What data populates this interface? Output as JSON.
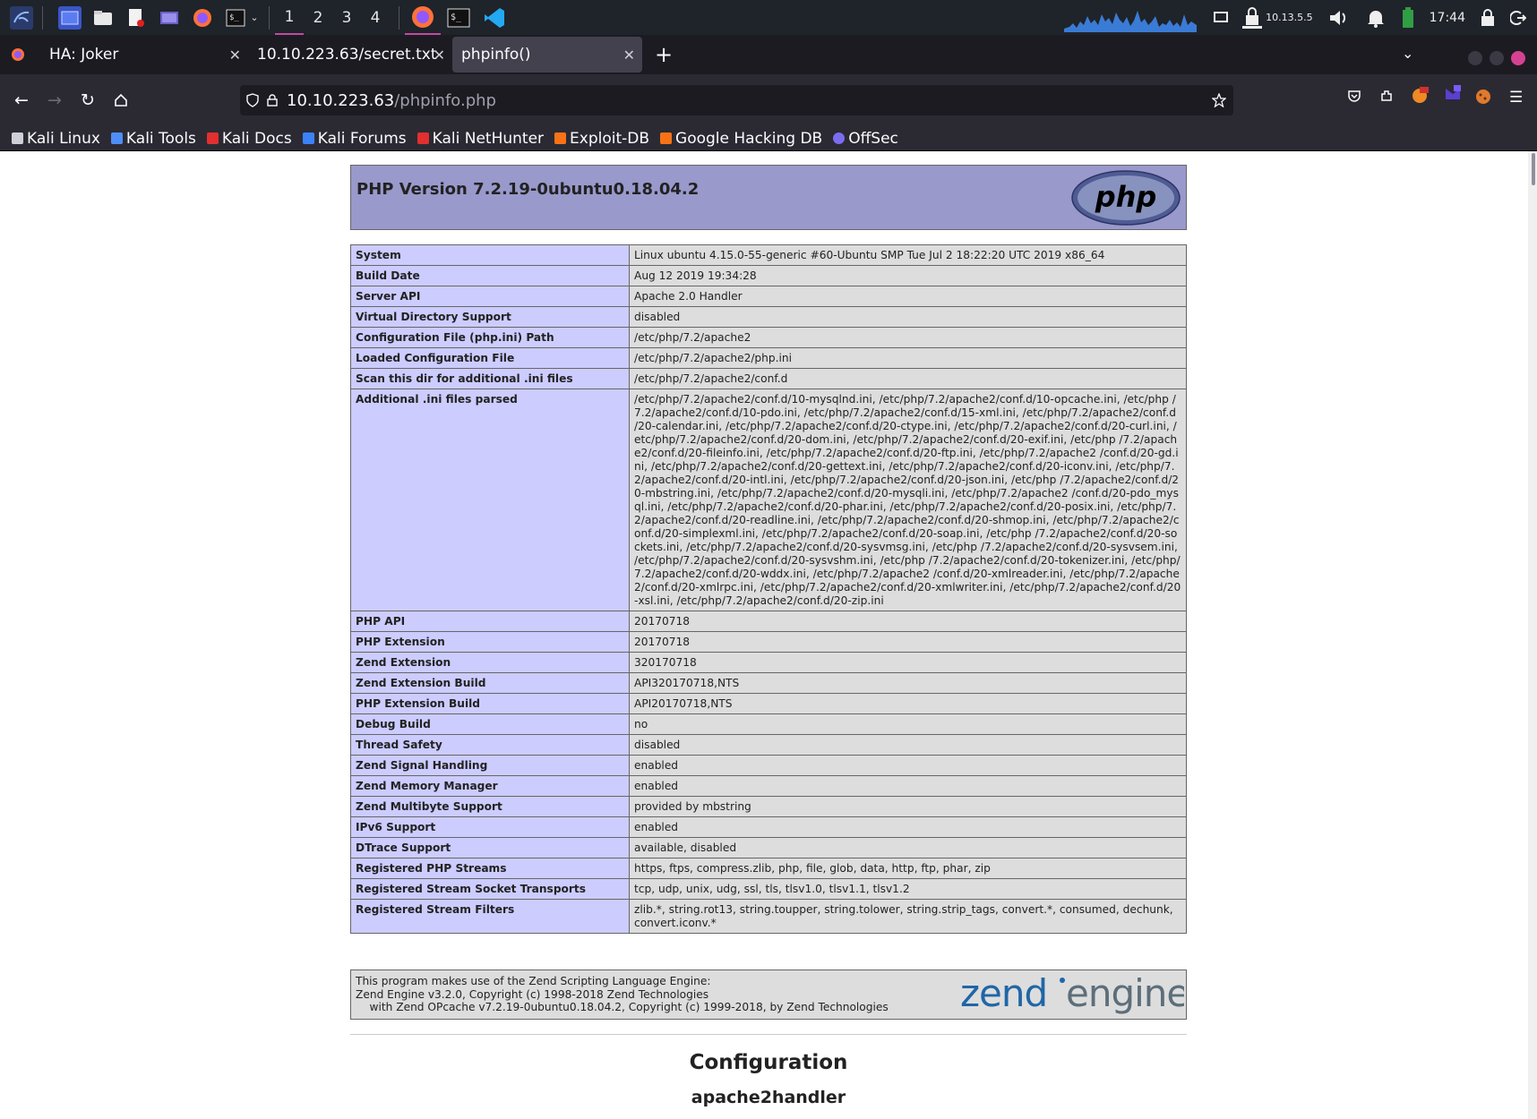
{
  "panel": {
    "workspaces": [
      "1",
      "2",
      "3",
      "4"
    ],
    "active_workspace": "1",
    "ip": "10.13.5.5",
    "clock": "17:44"
  },
  "tabs": [
    {
      "title": "HA: Joker",
      "active": false
    },
    {
      "title": "10.10.223.63/secret.txt",
      "active": false
    },
    {
      "title": "phpinfo()",
      "active": true
    }
  ],
  "url": {
    "host": "10.10.223.63",
    "path": "/phpinfo.php"
  },
  "bookmarks": [
    {
      "label": "Kali Linux",
      "color": "#cfcfd8"
    },
    {
      "label": "Kali Tools",
      "color": "#4f8ef7"
    },
    {
      "label": "Kali Docs",
      "color": "#e22f2f"
    },
    {
      "label": "Kali Forums",
      "color": "#3b82f6"
    },
    {
      "label": "Kali NetHunter",
      "color": "#e22f2f"
    },
    {
      "label": "Exploit-DB",
      "color": "#f97316"
    },
    {
      "label": "Google Hacking DB",
      "color": "#f97316"
    },
    {
      "label": "OffSec",
      "color": "#7c6cf0"
    }
  ],
  "phpinfo": {
    "version": "PHP Version 7.2.19-0ubuntu0.18.04.2",
    "logo_text": "php",
    "rows": [
      {
        "k": "System",
        "v": "Linux ubuntu 4.15.0-55-generic #60-Ubuntu SMP Tue Jul 2 18:22:20 UTC 2019 x86_64"
      },
      {
        "k": "Build Date",
        "v": "Aug 12 2019 19:34:28"
      },
      {
        "k": "Server API",
        "v": "Apache 2.0 Handler"
      },
      {
        "k": "Virtual Directory Support",
        "v": "disabled"
      },
      {
        "k": "Configuration File (php.ini) Path",
        "v": "/etc/php/7.2/apache2"
      },
      {
        "k": "Loaded Configuration File",
        "v": "/etc/php/7.2/apache2/php.ini"
      },
      {
        "k": "Scan this dir for additional .ini files",
        "v": "/etc/php/7.2/apache2/conf.d"
      },
      {
        "k": "Additional .ini files parsed",
        "v": "/etc/php/7.2/apache2/conf.d/10-mysqlnd.ini, /etc/php/7.2/apache2/conf.d/10-opcache.ini, /etc/php /7.2/apache2/conf.d/10-pdo.ini, /etc/php/7.2/apache2/conf.d/15-xml.ini, /etc/php/7.2/apache2/conf.d /20-calendar.ini, /etc/php/7.2/apache2/conf.d/20-ctype.ini, /etc/php/7.2/apache2/conf.d/20-curl.ini, /etc/php/7.2/apache2/conf.d/20-dom.ini, /etc/php/7.2/apache2/conf.d/20-exif.ini, /etc/php /7.2/apache2/conf.d/20-fileinfo.ini, /etc/php/7.2/apache2/conf.d/20-ftp.ini, /etc/php/7.2/apache2 /conf.d/20-gd.ini, /etc/php/7.2/apache2/conf.d/20-gettext.ini, /etc/php/7.2/apache2/conf.d/20-iconv.ini, /etc/php/7.2/apache2/conf.d/20-intl.ini, /etc/php/7.2/apache2/conf.d/20-json.ini, /etc/php /7.2/apache2/conf.d/20-mbstring.ini, /etc/php/7.2/apache2/conf.d/20-mysqli.ini, /etc/php/7.2/apache2 /conf.d/20-pdo_mysql.ini, /etc/php/7.2/apache2/conf.d/20-phar.ini, /etc/php/7.2/apache2/conf.d/20-posix.ini, /etc/php/7.2/apache2/conf.d/20-readline.ini, /etc/php/7.2/apache2/conf.d/20-shmop.ini, /etc/php/7.2/apache2/conf.d/20-simplexml.ini, /etc/php/7.2/apache2/conf.d/20-soap.ini, /etc/php /7.2/apache2/conf.d/20-sockets.ini, /etc/php/7.2/apache2/conf.d/20-sysvmsg.ini, /etc/php /7.2/apache2/conf.d/20-sysvsem.ini, /etc/php/7.2/apache2/conf.d/20-sysvshm.ini, /etc/php /7.2/apache2/conf.d/20-tokenizer.ini, /etc/php/7.2/apache2/conf.d/20-wddx.ini, /etc/php/7.2/apache2 /conf.d/20-xmlreader.ini, /etc/php/7.2/apache2/conf.d/20-xmlrpc.ini, /etc/php/7.2/apache2/conf.d/20-xmlwriter.ini, /etc/php/7.2/apache2/conf.d/20-xsl.ini, /etc/php/7.2/apache2/conf.d/20-zip.ini"
      },
      {
        "k": "PHP API",
        "v": "20170718"
      },
      {
        "k": "PHP Extension",
        "v": "20170718"
      },
      {
        "k": "Zend Extension",
        "v": "320170718"
      },
      {
        "k": "Zend Extension Build",
        "v": "API320170718,NTS"
      },
      {
        "k": "PHP Extension Build",
        "v": "API20170718,NTS"
      },
      {
        "k": "Debug Build",
        "v": "no"
      },
      {
        "k": "Thread Safety",
        "v": "disabled"
      },
      {
        "k": "Zend Signal Handling",
        "v": "enabled"
      },
      {
        "k": "Zend Memory Manager",
        "v": "enabled"
      },
      {
        "k": "Zend Multibyte Support",
        "v": "provided by mbstring"
      },
      {
        "k": "IPv6 Support",
        "v": "enabled"
      },
      {
        "k": "DTrace Support",
        "v": "available, disabled"
      },
      {
        "k": "Registered PHP Streams",
        "v": "https, ftps, compress.zlib, php, file, glob, data, http, ftp, phar, zip"
      },
      {
        "k": "Registered Stream Socket Transports",
        "v": "tcp, udp, unix, udg, ssl, tls, tlsv1.0, tlsv1.1, tlsv1.2"
      },
      {
        "k": "Registered Stream Filters",
        "v": "zlib.*, string.rot13, string.toupper, string.tolower, string.strip_tags, convert.*, consumed, dechunk, convert.iconv.*"
      }
    ],
    "zend_lines": [
      "This program makes use of the Zend Scripting Language Engine:",
      "Zend Engine v3.2.0, Copyright (c) 1998-2018 Zend Technologies",
      "    with Zend OPcache v7.2.19-0ubuntu0.18.04.2, Copyright (c) 1999-2018, by Zend Technologies"
    ],
    "zend_logo": {
      "word1": "zend",
      "word2": "engine"
    },
    "configuration_title": "Configuration",
    "configuration_sub": "apache2handler"
  }
}
